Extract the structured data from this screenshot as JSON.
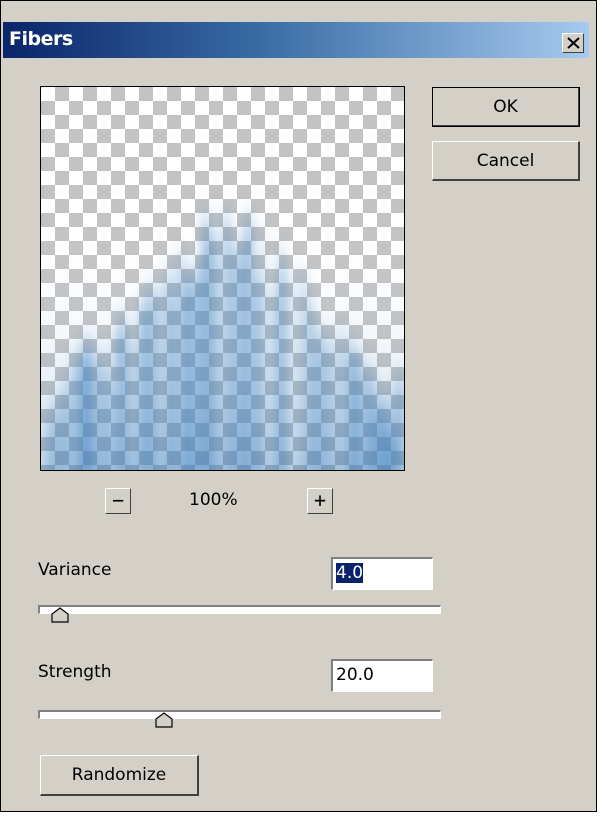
{
  "window": {
    "title": "Fibers"
  },
  "buttons": {
    "ok": "OK",
    "cancel": "Cancel",
    "randomize": "Randomize"
  },
  "zoom": {
    "out": "−",
    "in": "+",
    "level": "100%"
  },
  "variance": {
    "label": "Variance",
    "value": "4.0",
    "min": 1,
    "max": 64,
    "level": 0.05
  },
  "strength": {
    "label": "Strength",
    "value": "20.0",
    "min": 1,
    "max": 64,
    "level": 0.31
  },
  "colors": {
    "title_gradient_start": "#0a246a",
    "title_gradient_end": "#a6caf0",
    "dialog_bg": "#d4d0c8",
    "fiber_blue": "#3a7fc0"
  },
  "icons": {
    "close": "close-icon",
    "thumb": "slider-thumb-icon"
  }
}
